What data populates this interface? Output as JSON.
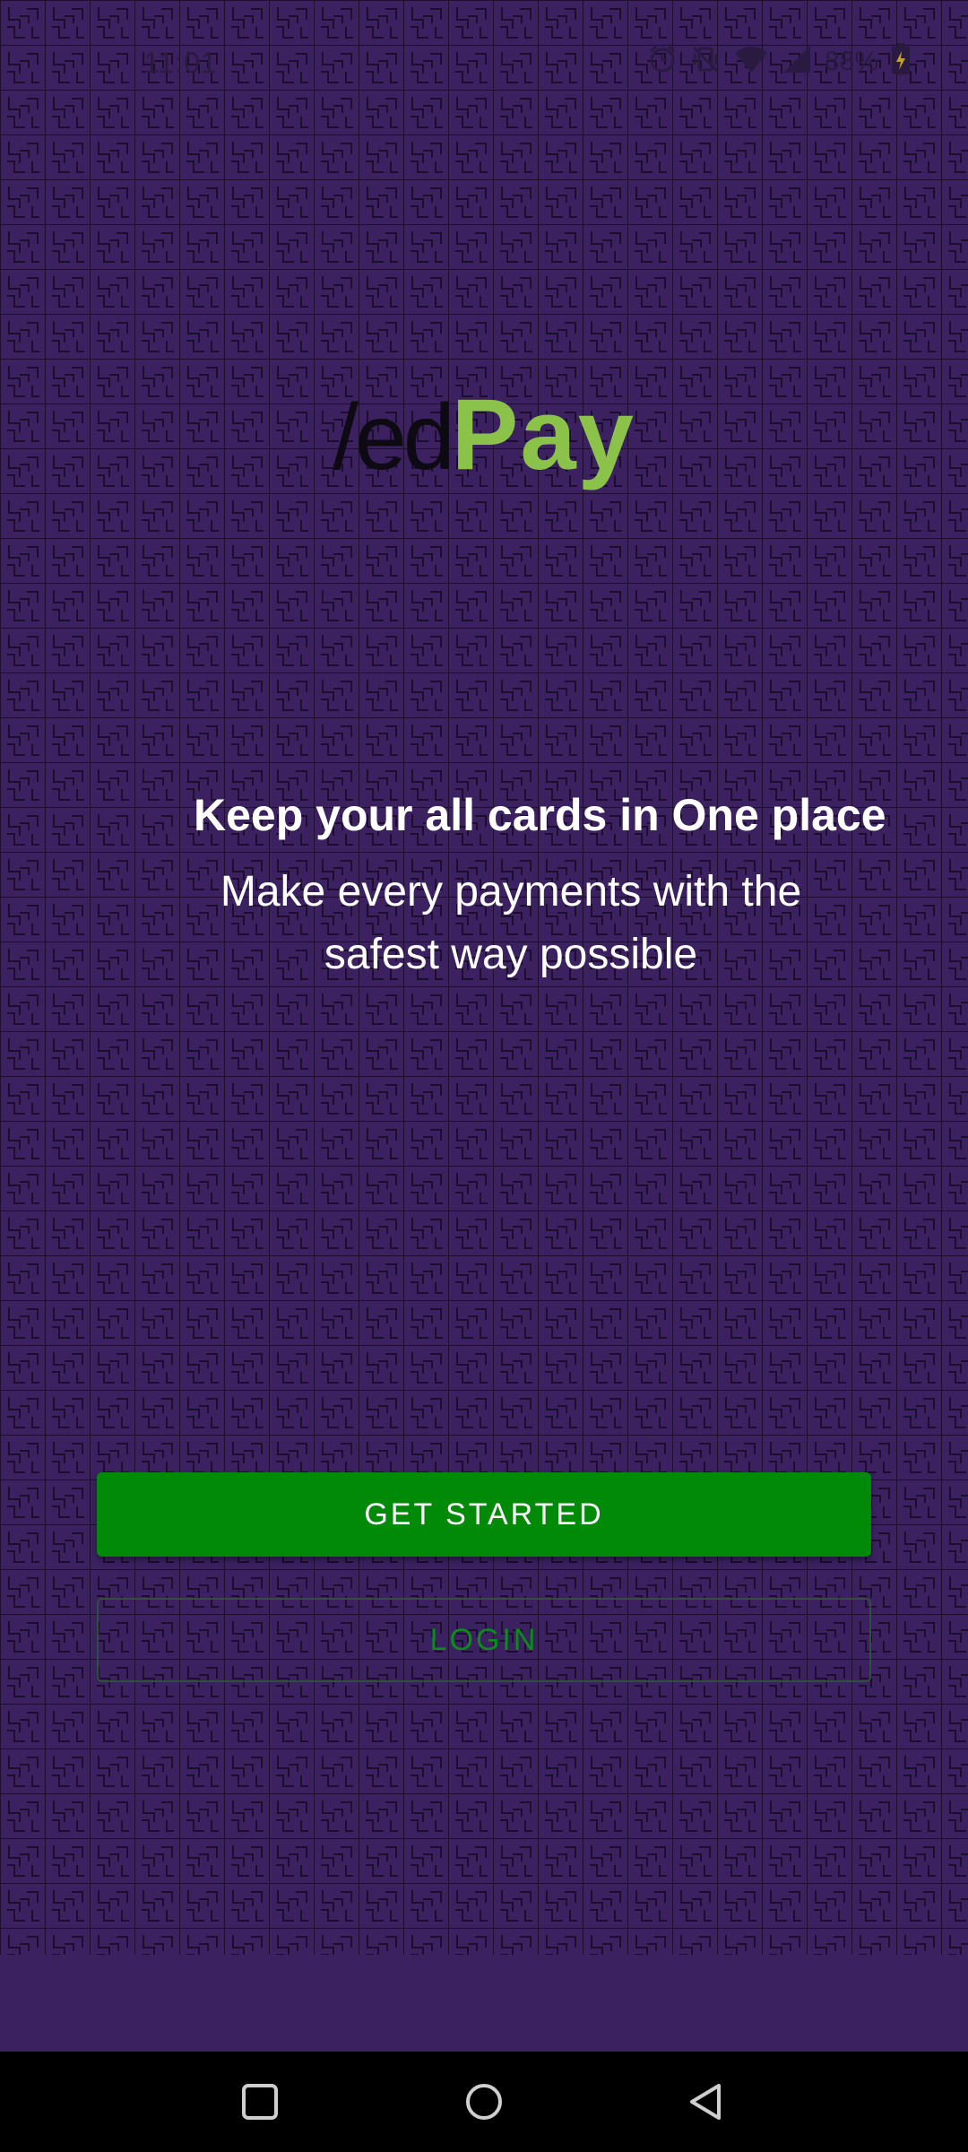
{
  "status_bar": {
    "time": "11:01",
    "battery_percent": "88%",
    "icons": [
      "alarm-icon",
      "vibrate-icon",
      "wifi-icon",
      "signal-icon",
      "battery-charging-icon"
    ]
  },
  "logo": {
    "prefix": "/ed",
    "suffix": "Pay"
  },
  "headline": "Keep your all cards in One place",
  "subline": "Make every payments with the safest way possible",
  "buttons": {
    "get_started": "GET STARTED",
    "login": "LOGIN"
  },
  "nav_bar": {
    "icons": [
      "recent-apps-icon",
      "home-icon",
      "back-icon"
    ]
  },
  "colors": {
    "background": "#3b2160",
    "primary_button": "#008a08",
    "logo_accent": "#8bc34a",
    "login_text": "#0b8a1d"
  }
}
